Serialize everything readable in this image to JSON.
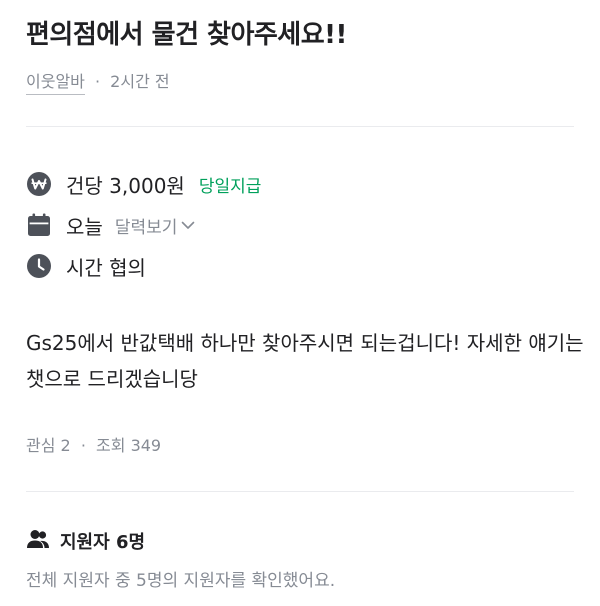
{
  "post": {
    "title": "편의점에서 물건 찾아주세요!!",
    "author": "이웃알바",
    "separator": "·",
    "time_ago": "2시간 전"
  },
  "details": {
    "pay": {
      "icon": "won-coin-icon",
      "text": "건당 3,000원",
      "badge": "당일지급",
      "badge_color": "#00a05b"
    },
    "date": {
      "icon": "calendar-icon",
      "text": "오늘",
      "calendar_link": "달력보기"
    },
    "time": {
      "icon": "clock-icon",
      "text": "시간 협의"
    }
  },
  "description": "Gs25에서 반값택배 하나만 찾아주시면 되는겁니다! 자세한 얘기는 챗으로 드리겠습니당",
  "stats": {
    "interest_label": "관심",
    "interest_count": "2",
    "separator": "·",
    "views_label": "조회",
    "views_count": "349"
  },
  "applicants": {
    "icon": "people-icon",
    "label": "지원자 6명",
    "note": "전체 지원자 중 5명의 지원자를 확인했어요."
  },
  "colors": {
    "text_primary": "#212124",
    "text_secondary": "#868b94",
    "accent_green": "#00a05b",
    "icon_gray": "#4d5159",
    "divider": "#eaebee"
  }
}
